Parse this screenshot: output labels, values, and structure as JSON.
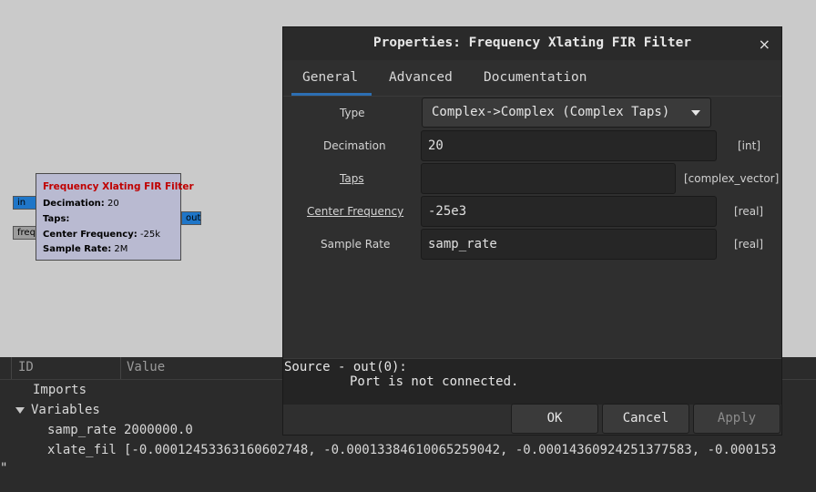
{
  "flowgraph": {
    "block": {
      "title": "Frequency Xlating FIR Filter",
      "decimation_label": "Decimation:",
      "decimation_value": "20",
      "taps_label": "Taps:",
      "center_label": "Center Frequency:",
      "center_value": "-25k",
      "rate_label": "Sample Rate:",
      "rate_value": "2M"
    },
    "ports": {
      "in": "in",
      "freq": "freq",
      "out": "out"
    }
  },
  "variables_panel": {
    "col_id": "ID",
    "col_value": "Value",
    "imports": "Imports",
    "variables": "Variables",
    "rows": [
      {
        "id": "samp_rate",
        "value": "2000000.0"
      },
      {
        "id": "xlate_fil",
        "value": "[-0.00012453363160602748, -0.00013384610065259042, -0.00014360924251377583, -0.000153"
      }
    ],
    "stray_text": "\""
  },
  "dialog": {
    "title": "Properties: Frequency Xlating FIR Filter",
    "close_glyph": "×",
    "tabs": [
      "General",
      "Advanced",
      "Documentation"
    ],
    "fields": {
      "type_label": "Type",
      "type_value": "Complex->Complex (Complex Taps)",
      "decimation_label": "Decimation",
      "decimation_value": "20",
      "decimation_unit": "[int]",
      "taps_label": "Taps",
      "taps_value": "",
      "taps_unit": "[complex_vector]",
      "center_label": "Center Frequency",
      "center_value": "-25e3",
      "center_unit": "[real]",
      "rate_label": "Sample Rate",
      "rate_value": "samp_rate",
      "rate_unit": "[real]"
    },
    "message_line1": "Source - out(0):",
    "message_line2": "Port is not connected.",
    "buttons": {
      "ok": "OK",
      "cancel": "Cancel",
      "apply": "Apply"
    }
  }
}
